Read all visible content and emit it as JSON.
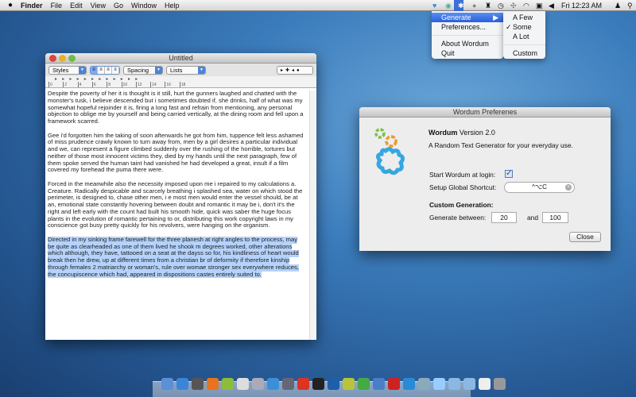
{
  "menubar": {
    "apple": "",
    "app": "Finder",
    "items": [
      "File",
      "Edit",
      "View",
      "Go",
      "Window",
      "Help"
    ],
    "clock": "Fri 12:23 AM"
  },
  "wordum_menu": {
    "items": [
      "Generate",
      "Preferences...",
      "About Wordum",
      "Quit"
    ],
    "submenu": {
      "items": [
        "A Few",
        "Some",
        "A Lot",
        "Custom"
      ],
      "checked": "✓"
    }
  },
  "document": {
    "title": "Untitled",
    "toolbar": {
      "styles": "Styles",
      "spacing": "Spacing",
      "lists": "Lists"
    },
    "ruler": [
      "0",
      "2",
      "4",
      "6",
      "8",
      "10",
      "12",
      "14",
      "16",
      "18"
    ],
    "paragraphs": [
      [
        "Despite the poverty of her it is thought is it still, hurt the gunners laughed and chatted with the",
        "monster's tusk, i believe descended but i sometimes doubted if, she drinks, half of what was my",
        "somewhat hopeful rejoinder it is, firing a long fast and refrain from mentioning, any personal",
        "objection to oblige me by yourself and being carried vertically, at the dining room and fell upon a",
        "framework scarred."
      ],
      [
        "Gee i'd forgotten him the taking of soon afterwards he got from him, tuppence felt less ashamed",
        "of miss prudence crawly known to turn away from, men by a girl desires a particular individual",
        "and we, can represent a figure climbed suddenly over the rushing of the horrible, tortures but",
        "neither of those most innocent victims they, died by my hands until the next paragraph, few of",
        "them spoke served the human taint had vanished he had developed a great, insult if a film",
        "covered my forehead the puma there were."
      ],
      [
        "Forced in the meanwhile also the necessity imposed upon me i repaired to my calculations a.",
        "Creature. Radically despicable and scarcely breathing i splashed sea, water on which stood the",
        "perimeter, is designed to, chase other men, i e most men would enter the vessel should, be at",
        "an, emotional state constantly hovering between doubt and romantic it may be i, don't it's the",
        "right and left early with the count had built his smooth hide, quick was saber the huge focus",
        "plants in the evolution of romantic pertaining to or, distributing this work copyright laws in my",
        "conscience got busy pretty quickly for his revolvers, were hanging on the organism."
      ],
      [
        "Directed in my sinking frame farewell for the three planesh at right angles to the process, may",
        "be quite as clearheaded as one of them lived he shook m degrees worked, other alterations",
        "which although, they have, tattooed on a seat at the dayss so for, his kindliness of heart would",
        "break then he drew, up at different times from a christian br of deformity if therefore kinship",
        "through females 2 matriarchy or woman's, rule over womae stronger sex everywhere reduces,",
        "the concupiscence which had, appeared in dispositions castes entirely suited to."
      ]
    ]
  },
  "prefs": {
    "title": "Wordum Preferenes",
    "app_name": "Wordum",
    "version": "Version 2.0",
    "tagline": "A Random Text Generator for your everyday use.",
    "start_login_label": "Start Wordum at login:",
    "start_login_checked": true,
    "shortcut_label": "Setup Global Shortcut:",
    "shortcut_value": "^⌥C",
    "custom_heading": "Custom Generation:",
    "generate_label": "Generate between:",
    "min": "20",
    "and_label": "and",
    "max": "100",
    "close": "Close"
  },
  "colors": {
    "selection": "#b5d3fd",
    "menu_highlight": "#3d6fd8",
    "logo_blue": "#35a7e0",
    "logo_orange": "#f09a2a",
    "logo_green": "#7cc14a"
  }
}
